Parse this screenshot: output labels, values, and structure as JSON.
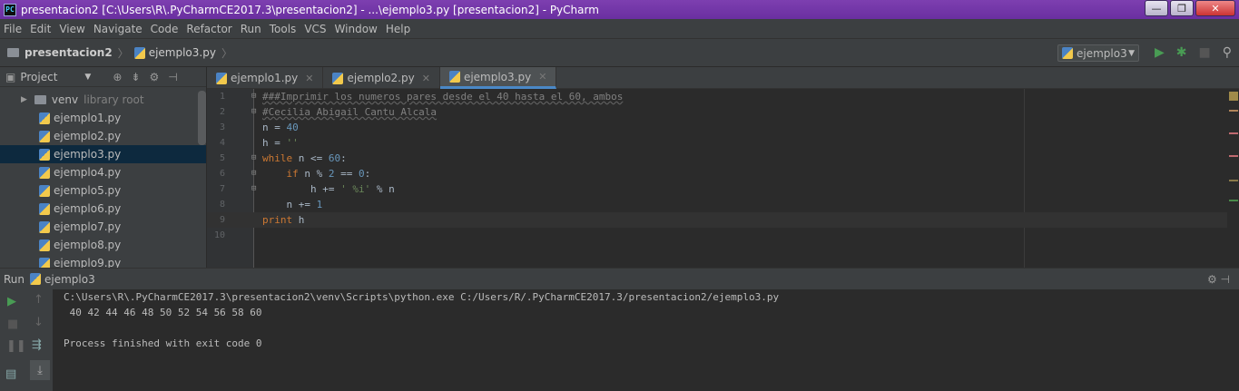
{
  "window": {
    "app_icon": "PC",
    "title": "presentacion2 [C:\\Users\\R\\.PyCharmCE2017.3\\presentacion2] - ...\\ejemplo3.py [presentacion2] - PyCharm",
    "minimize": "—",
    "maximize": "❐",
    "close": "✕"
  },
  "menu": [
    "File",
    "Edit",
    "View",
    "Navigate",
    "Code",
    "Refactor",
    "Run",
    "Tools",
    "VCS",
    "Window",
    "Help"
  ],
  "breadcrumb": {
    "project": "presentacion2",
    "file": "ejemplo3.py"
  },
  "run_config": {
    "name": "ejemplo3"
  },
  "project_panel": {
    "title": "Project",
    "items": [
      {
        "label": "venv",
        "note": "library root"
      },
      {
        "label": "ejemplo1.py"
      },
      {
        "label": "ejemplo2.py"
      },
      {
        "label": "ejemplo3.py"
      },
      {
        "label": "ejemplo4.py"
      },
      {
        "label": "ejemplo5.py"
      },
      {
        "label": "ejemplo6.py"
      },
      {
        "label": "ejemplo7.py"
      },
      {
        "label": "ejemplo8.py"
      },
      {
        "label": "ejemplo9.py"
      }
    ]
  },
  "tabs": [
    {
      "label": "ejemplo1.py"
    },
    {
      "label": "ejemplo2.py"
    },
    {
      "label": "ejemplo3.py"
    }
  ],
  "code": {
    "line_numbers": [
      "1",
      "2",
      "3",
      "4",
      "5",
      "6",
      "7",
      "8",
      "9",
      "10"
    ],
    "l1": "###Imprimir los numeros pares desde el 40 hasta el 60, ambos",
    "l2": "#Cecilia Abigail Cantu Alcala",
    "l3a": "n = ",
    "l3b": "40",
    "l4a": "h = ",
    "l4b": "''",
    "l5a": "while",
    "l5b": " n <= ",
    "l5c": "60",
    "l5d": ":",
    "l6a": "    if",
    "l6b": " n % ",
    "l6c": "2",
    "l6d": " == ",
    "l6e": "0",
    "l6f": ":",
    "l7a": "        h += ",
    "l7b": "' %i'",
    "l7c": " % n",
    "l8a": "    n += ",
    "l8b": "1",
    "l9a": "print",
    "l9b": " h"
  },
  "run_panel": {
    "label": "Run",
    "config": "ejemplo3",
    "output": [
      "C:\\Users\\R\\.PyCharmCE2017.3\\presentacion2\\venv\\Scripts\\python.exe C:/Users/R/.PyCharmCE2017.3/presentacion2/ejemplo3.py",
      " 40 42 44 46 48 50 52 54 56 58 60",
      "",
      "Process finished with exit code 0"
    ]
  }
}
